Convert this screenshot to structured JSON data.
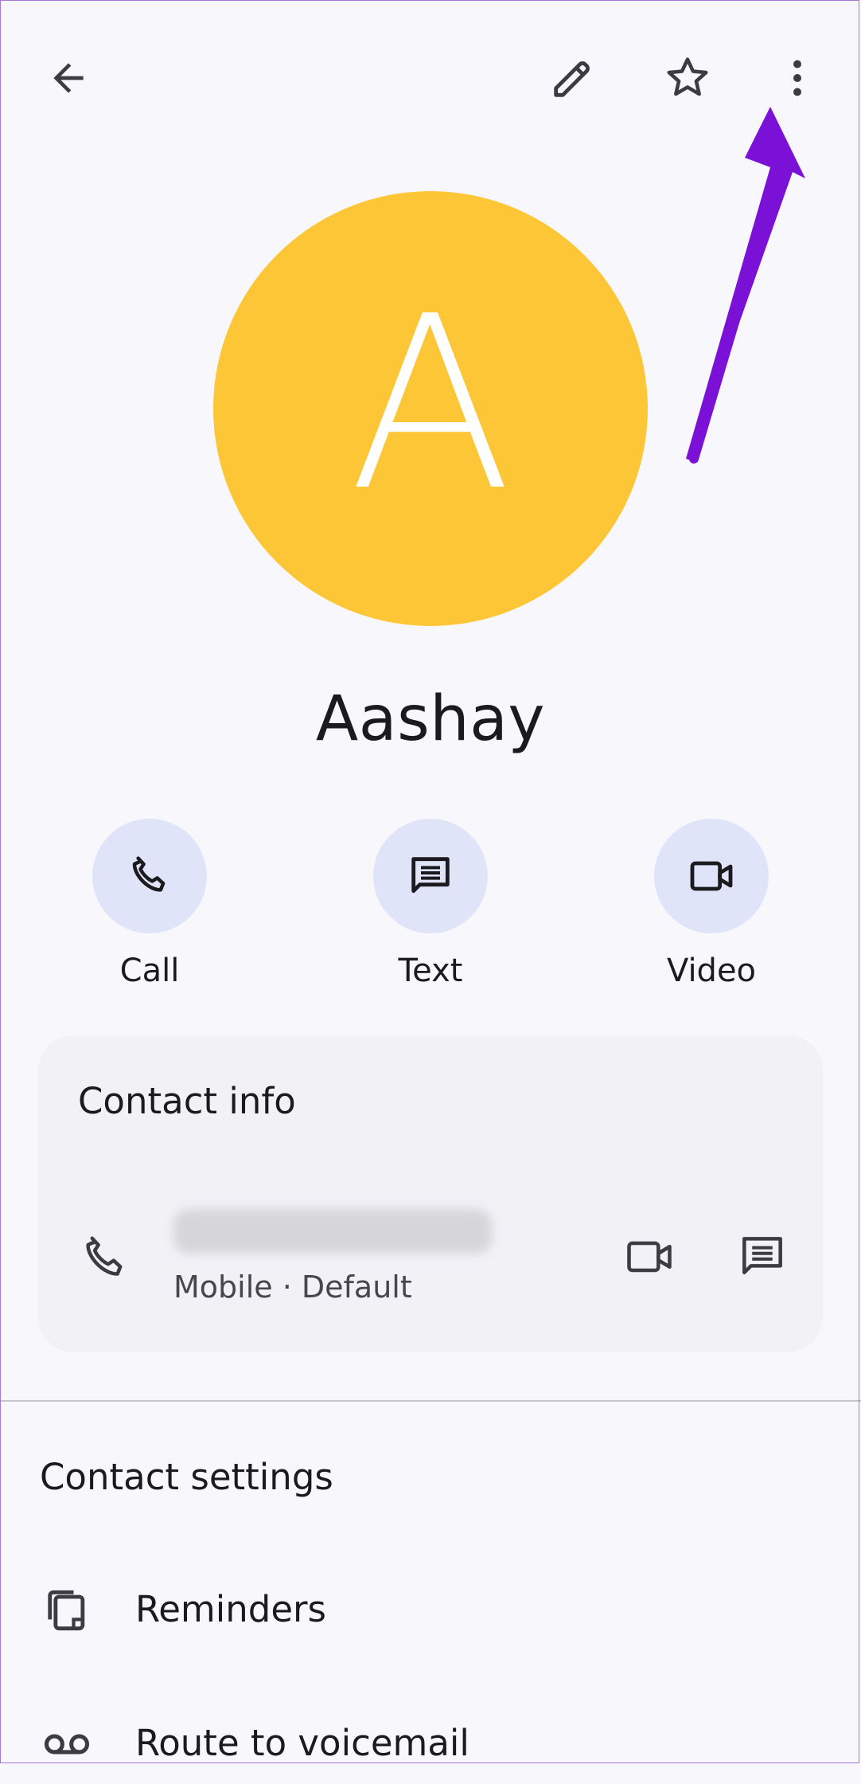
{
  "toolbar": {
    "back_icon": "arrow-back-icon",
    "edit_icon": "pencil-icon",
    "favorite_icon": "star-outline-icon",
    "more_icon": "more-vertical-icon"
  },
  "contact": {
    "initial": "A",
    "name": "Aashay",
    "avatar_color": "#fdc636"
  },
  "actions": [
    {
      "label": "Call",
      "icon": "phone-icon"
    },
    {
      "label": "Text",
      "icon": "message-icon"
    },
    {
      "label": "Video",
      "icon": "videocam-icon"
    }
  ],
  "contact_info": {
    "title": "Contact info",
    "phone_sub": "Mobile · Default"
  },
  "settings": {
    "title": "Contact settings",
    "items": [
      {
        "label": "Reminders",
        "icon": "reminders-icon"
      },
      {
        "label": "Route to voicemail",
        "icon": "voicemail-icon"
      }
    ]
  },
  "annotation": {
    "arrow_color": "#7b10d6"
  }
}
